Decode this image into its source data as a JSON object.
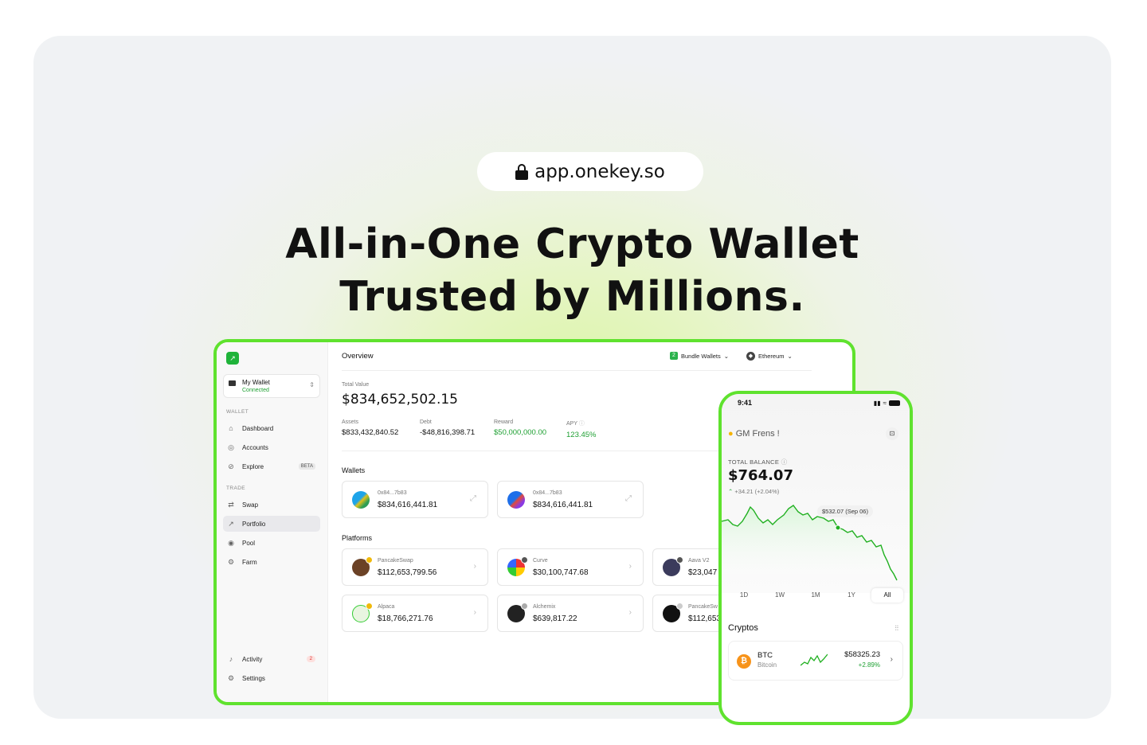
{
  "hero": {
    "url": "app.onekey.so",
    "headline_1": "All-in-One Crypto Wallet",
    "headline_2": "Trusted by Millions."
  },
  "desktop": {
    "logo_glyph": "↗",
    "wallet": {
      "name": "My Wallet",
      "status": "Connected"
    },
    "sections": {
      "wallet": "WALLET",
      "trade": "TRADE"
    },
    "nav": {
      "dashboard": "Dashboard",
      "accounts": "Accounts",
      "explore": "Explore",
      "explore_badge": "BETA",
      "swap": "Swap",
      "portfolio": "Portfolio",
      "pool": "Pool",
      "farm": "Farm",
      "activity": "Activity",
      "activity_count": "2",
      "settings": "Settings"
    },
    "topbar": {
      "title": "Overview",
      "bundle_count": "2",
      "bundle_label": "Bundle Wallets",
      "network": "Ethereum"
    },
    "total": {
      "label": "Total Value",
      "value": "$834,652,502.15"
    },
    "stats": [
      {
        "label": "Assets",
        "value": "$833,432,840.52"
      },
      {
        "label": "Debt",
        "value": "-$48,816,398.71"
      },
      {
        "label": "Reward",
        "value": "$50,000,000.00"
      },
      {
        "label": "APY",
        "value": "123.45%"
      }
    ],
    "wallets_title": "Wallets",
    "wallets": [
      {
        "address": "0x84...7b83",
        "value": "$834,616,441.81"
      },
      {
        "address": "0x84...7b83",
        "value": "$834,616,441.81"
      }
    ],
    "platforms_title": "Platforms",
    "platforms": [
      {
        "name": "PancakeSwap",
        "value": "$112,653,799.56"
      },
      {
        "name": "Curve",
        "value": "$30,100,747.68"
      },
      {
        "name": "Aava V2",
        "value": "$23,047"
      },
      {
        "name": "Alpaca",
        "value": "$18,766,271.76"
      },
      {
        "name": "Alchemix",
        "value": "$639,817.22"
      },
      {
        "name": "PancakeSw",
        "value": "$112,653"
      }
    ]
  },
  "phone": {
    "time": "9:41",
    "greeting": "GM Frens !",
    "balance_label": "TOTAL BALANCE",
    "balance": "$764.07",
    "change": "+34.21 (+2.04%)",
    "tooltip": "$532.07 (Sep 06)",
    "ranges": [
      "1D",
      "1W",
      "1M",
      "1Y",
      "All"
    ],
    "selected_range": "All",
    "cryptos_title": "Cryptos",
    "crypto": {
      "symbol": "BTC",
      "name": "Bitcoin",
      "price": "$58325.23",
      "change": "+2.89%"
    }
  },
  "colors": {
    "accent_green": "#5fe22e",
    "positive": "#1fa033",
    "btc": "#f7931a"
  }
}
